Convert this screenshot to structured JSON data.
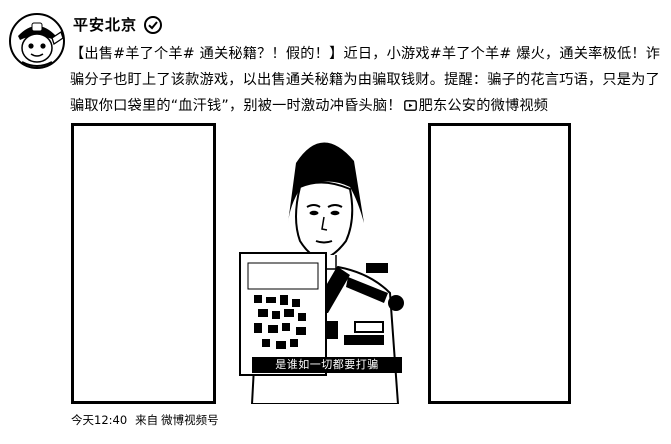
{
  "post": {
    "author": "平安北京",
    "text_parts": [
      "【出售#羊了个羊# 通关秘籍？！假的！】近日，小游戏#羊了个羊# 爆火，通关率极低！诈骗分子也盯上了该款游戏，以出售通关秘籍为由骗取钱财。提醒：骗子的花言巧语，只是为了骗取你口袋里的“血汗钱”，别被一时激动冲昏头脑！",
      "肥东公安的微博视频"
    ],
    "video_caption": "是谁如一切都要打骗",
    "timestamp": "今天12:40",
    "source_label": "来自",
    "source_name": "微博视频号"
  },
  "icons": {
    "avatar": "police-mascot-avatar",
    "verified": "verified-badge-icon",
    "video_link": "video-link-icon"
  },
  "colors": {
    "text": "#000000",
    "background": "#ffffff"
  }
}
